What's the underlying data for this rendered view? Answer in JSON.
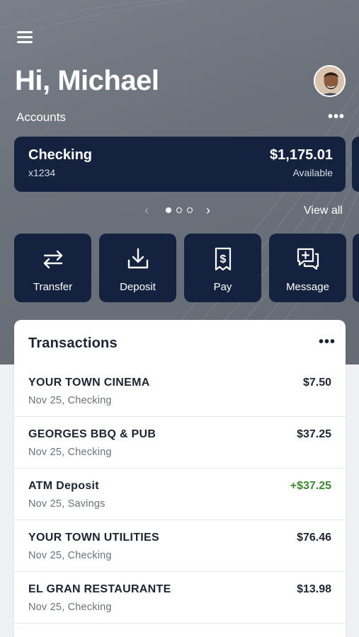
{
  "header": {
    "greeting": "Hi, Michael",
    "accounts_label": "Accounts",
    "more_glyph": "•••"
  },
  "account": {
    "name": "Checking",
    "number": "x1234",
    "balance": "$1,175.01",
    "balance_label": "Available"
  },
  "carousel": {
    "prev_glyph": "‹",
    "next_glyph": "›",
    "pages": 3,
    "active_page": 1,
    "view_all": "View all"
  },
  "actions": [
    {
      "label": "Transfer",
      "icon": "transfer-icon"
    },
    {
      "label": "Deposit",
      "icon": "deposit-icon"
    },
    {
      "label": "Pay",
      "icon": "pay-icon"
    },
    {
      "label": "Message",
      "icon": "message-icon"
    }
  ],
  "transactions": {
    "title": "Transactions",
    "more_glyph": "•••",
    "items": [
      {
        "merchant": "YOUR TOWN CINEMA",
        "detail": "Nov 25, Checking",
        "amount": "$7.50",
        "credit": false
      },
      {
        "merchant": "GEORGES BBQ & PUB",
        "detail": "Nov 25, Checking",
        "amount": "$37.25",
        "credit": false
      },
      {
        "merchant": "ATM Deposit",
        "detail": "Nov 25, Savings",
        "amount": "+$37.25",
        "credit": true
      },
      {
        "merchant": "YOUR TOWN UTILITIES",
        "detail": "Nov 25, Checking",
        "amount": "$76.46",
        "credit": false
      },
      {
        "merchant": "EL GRAN RESTAURANTE",
        "detail": "Nov 25, Checking",
        "amount": "$13.98",
        "credit": false
      }
    ]
  },
  "colors": {
    "card_navy": "#14223f",
    "credit_green": "#3a8a2d"
  }
}
